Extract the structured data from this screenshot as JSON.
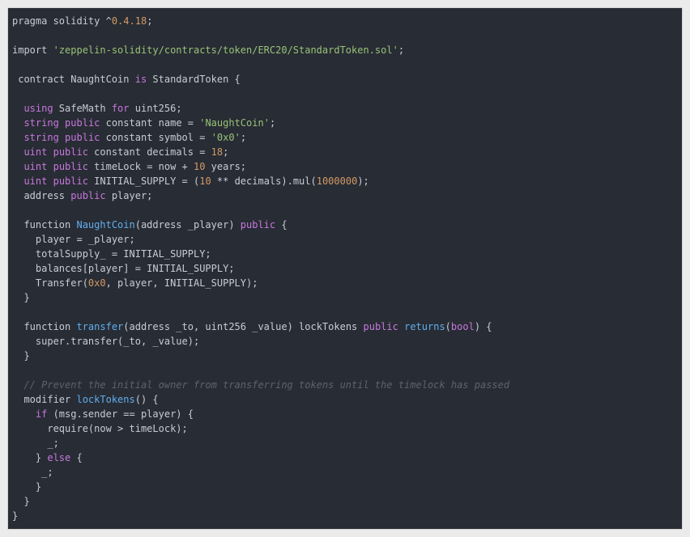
{
  "colors": {
    "background": "#282c34",
    "text": "#c8ccd4",
    "keyword": "#c678dd",
    "string": "#98c379",
    "number": "#d19a66",
    "function": "#61afef",
    "comment": "#5c6370",
    "page": "#ebebeb"
  },
  "code_lines": [
    [
      [
        "p",
        "pragma solidity ^"
      ],
      [
        "num",
        "0.4.18"
      ],
      [
        "p",
        ";"
      ]
    ],
    [],
    [
      [
        "p",
        "import "
      ],
      [
        "str",
        "'zeppelin-solidity/contracts/token/ERC20/StandardToken.sol'"
      ],
      [
        "p",
        ";"
      ]
    ],
    [],
    [
      [
        "p",
        " contract NaughtCoin "
      ],
      [
        "kw",
        "is"
      ],
      [
        "p",
        " StandardToken {"
      ]
    ],
    [],
    [
      [
        "p",
        "  "
      ],
      [
        "kw",
        "using"
      ],
      [
        "p",
        " SafeMath "
      ],
      [
        "kw",
        "for"
      ],
      [
        "p",
        " uint256;"
      ]
    ],
    [
      [
        "p",
        "  "
      ],
      [
        "kw",
        "string"
      ],
      [
        "p",
        " "
      ],
      [
        "kw",
        "public"
      ],
      [
        "p",
        " constant name = "
      ],
      [
        "str",
        "'NaughtCoin'"
      ],
      [
        "p",
        ";"
      ]
    ],
    [
      [
        "p",
        "  "
      ],
      [
        "kw",
        "string"
      ],
      [
        "p",
        " "
      ],
      [
        "kw",
        "public"
      ],
      [
        "p",
        " constant symbol = "
      ],
      [
        "str",
        "'0x0'"
      ],
      [
        "p",
        ";"
      ]
    ],
    [
      [
        "p",
        "  "
      ],
      [
        "kw",
        "uint"
      ],
      [
        "p",
        " "
      ],
      [
        "kw",
        "public"
      ],
      [
        "p",
        " constant decimals = "
      ],
      [
        "num",
        "18"
      ],
      [
        "p",
        ";"
      ]
    ],
    [
      [
        "p",
        "  "
      ],
      [
        "kw",
        "uint"
      ],
      [
        "p",
        " "
      ],
      [
        "kw",
        "public"
      ],
      [
        "p",
        " timeLock = now + "
      ],
      [
        "num",
        "10"
      ],
      [
        "p",
        " years;"
      ]
    ],
    [
      [
        "p",
        "  "
      ],
      [
        "kw",
        "uint"
      ],
      [
        "p",
        " "
      ],
      [
        "kw",
        "public"
      ],
      [
        "p",
        " INITIAL_SUPPLY = ("
      ],
      [
        "num",
        "10"
      ],
      [
        "p",
        " ** decimals).mul("
      ],
      [
        "num",
        "1000000"
      ],
      [
        "p",
        ");"
      ]
    ],
    [
      [
        "p",
        "  address "
      ],
      [
        "kw",
        "public"
      ],
      [
        "p",
        " player;"
      ]
    ],
    [],
    [
      [
        "p",
        "  function "
      ],
      [
        "fn",
        "NaughtCoin"
      ],
      [
        "p",
        "(address _player) "
      ],
      [
        "kw",
        "public"
      ],
      [
        "p",
        " {"
      ]
    ],
    [
      [
        "p",
        "    player = _player;"
      ]
    ],
    [
      [
        "p",
        "    totalSupply_ = INITIAL_SUPPLY;"
      ]
    ],
    [
      [
        "p",
        "    balances[player] = INITIAL_SUPPLY;"
      ]
    ],
    [
      [
        "p",
        "    Transfer("
      ],
      [
        "num",
        "0x0"
      ],
      [
        "p",
        ", player, INITIAL_SUPPLY);"
      ]
    ],
    [
      [
        "p",
        "  }"
      ]
    ],
    [],
    [
      [
        "p",
        "  function "
      ],
      [
        "fn",
        "transfer"
      ],
      [
        "p",
        "(address _to, uint256 _value) lockTokens "
      ],
      [
        "kw",
        "public"
      ],
      [
        "p",
        " "
      ],
      [
        "fn",
        "returns"
      ],
      [
        "p",
        "("
      ],
      [
        "kw",
        "bool"
      ],
      [
        "p",
        ") {"
      ]
    ],
    [
      [
        "p",
        "    super.transfer(_to, _value);"
      ]
    ],
    [
      [
        "p",
        "  }"
      ]
    ],
    [],
    [
      [
        "p",
        "  "
      ],
      [
        "cm",
        "// Prevent the initial owner from transferring tokens until the timelock has passed"
      ]
    ],
    [
      [
        "p",
        "  modifier "
      ],
      [
        "fn",
        "lockTokens"
      ],
      [
        "p",
        "() {"
      ]
    ],
    [
      [
        "p",
        "    "
      ],
      [
        "kw",
        "if"
      ],
      [
        "p",
        " (msg.sender == player) {"
      ]
    ],
    [
      [
        "p",
        "      require(now > timeLock);"
      ]
    ],
    [
      [
        "p",
        "      _;"
      ]
    ],
    [
      [
        "p",
        "    } "
      ],
      [
        "kw",
        "else"
      ],
      [
        "p",
        " {"
      ]
    ],
    [
      [
        "p",
        "     _;"
      ]
    ],
    [
      [
        "p",
        "    }"
      ]
    ],
    [
      [
        "p",
        "  }"
      ]
    ],
    [
      [
        "p",
        "}"
      ]
    ]
  ]
}
